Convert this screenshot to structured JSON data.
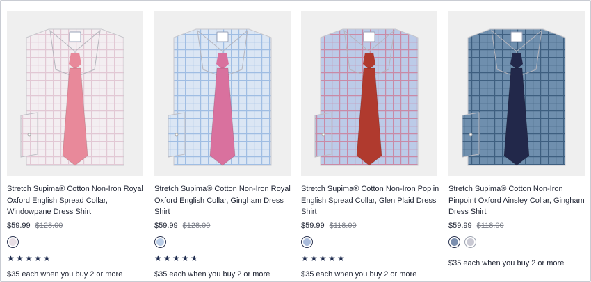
{
  "products": [
    {
      "title": "Stretch Supima® Cotton Non-Iron Royal Oxford English Spread Collar, Windowpane Dress Shirt",
      "price": "$59.99",
      "original_price": "$128.00",
      "swatches": [
        {
          "color": "#e8dfe6",
          "selected": true
        }
      ],
      "rating": 4.5,
      "promo": "$35 each when you buy 2 or more",
      "shirt_color": "#f3eef1",
      "pattern_color": "#e2c8d4",
      "tie_color": "#e8899a"
    },
    {
      "title": "Stretch Supima® Cotton Non-Iron Royal Oxford English Collar, Gingham Dress Shirt",
      "price": "$59.99",
      "original_price": "$128.00",
      "swatches": [
        {
          "color": "#b9cce6",
          "selected": true
        }
      ],
      "rating": 4.5,
      "promo": "$35 each when you buy 2 or more",
      "shirt_color": "#dbe6f4",
      "pattern_color": "#9fbde3",
      "tie_color": "#d9719e"
    },
    {
      "title": "Stretch Supima® Cotton Non-Iron Poplin English Spread Collar, Glen Plaid Dress Shirt",
      "price": "$59.99",
      "original_price": "$118.00",
      "swatches": [
        {
          "color": "#a9bbdb",
          "selected": true
        }
      ],
      "rating": 5,
      "promo": "$35 each when you buy 2 or more",
      "shirt_color": "#bccbe8",
      "pattern_color": "#c98aa6",
      "tie_color": "#b03a2e"
    },
    {
      "title": "Stretch Supima® Cotton Non-Iron Pinpoint Oxford Ainsley Collar, Gingham Dress Shirt",
      "price": "$59.99",
      "original_price": "$118.00",
      "swatches": [
        {
          "color": "#7b8faf",
          "selected": true
        },
        {
          "color": "#c9c9d3",
          "selected": false
        }
      ],
      "rating": null,
      "promo": "$35 each when you buy 2 or more",
      "shirt_color": "#6f8fae",
      "pattern_color": "#3e5f80",
      "tie_color": "#22284a"
    }
  ]
}
